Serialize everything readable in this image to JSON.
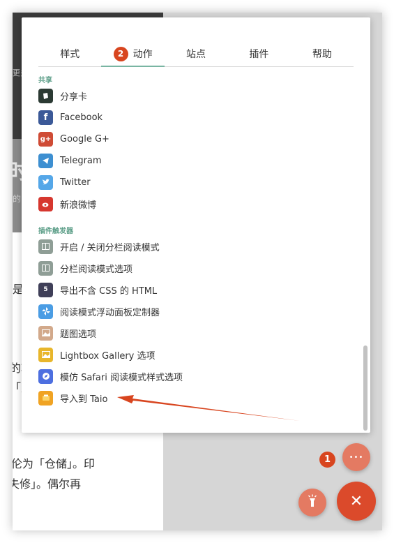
{
  "tabs": [
    {
      "label": "样式"
    },
    {
      "label": "动作",
      "badge": "2"
    },
    {
      "label": "站点"
    },
    {
      "label": "插件"
    },
    {
      "label": "帮助"
    }
  ],
  "share": {
    "title": "共享",
    "items": [
      {
        "label": "分享卡",
        "icon": "share-card-icon",
        "color": "#2b3a33"
      },
      {
        "label": "Facebook",
        "icon": "facebook-icon",
        "color": "#3b5998"
      },
      {
        "label": "Google G+",
        "icon": "google-plus-icon",
        "color": "#cf4b35"
      },
      {
        "label": "Telegram",
        "icon": "telegram-icon",
        "color": "#3d8fd1"
      },
      {
        "label": "Twitter",
        "icon": "twitter-icon",
        "color": "#55a7e8"
      },
      {
        "label": "新浪微博",
        "icon": "weibo-icon",
        "color": "#d6372f"
      }
    ]
  },
  "triggers": {
    "title": "插件触发器",
    "items": [
      {
        "label": "开启 / 关闭分栏阅读模式",
        "icon": "columns-icon",
        "color": "#8f9e96"
      },
      {
        "label": "分栏阅读模式选项",
        "icon": "columns-options-icon",
        "color": "#8f9e96"
      },
      {
        "label": "导出不含 CSS 的 HTML",
        "icon": "html5-icon",
        "color": "#3f3f58"
      },
      {
        "label": "阅读模式浮动面板定制器",
        "icon": "pinwheel-icon",
        "color": "#4b9de4"
      },
      {
        "label": "题图选项",
        "icon": "cover-image-icon",
        "color": "#d2a98b"
      },
      {
        "label": "Lightbox Gallery 选项",
        "icon": "gallery-icon",
        "color": "#e8b62b"
      },
      {
        "label": "模仿 Safari 阅读模式样式选项",
        "icon": "compass-icon",
        "color": "#4d6fe0"
      },
      {
        "label": "导入到 Taio",
        "icon": "taio-icon",
        "color": "#f0a323"
      }
    ]
  },
  "fabs": {
    "more_badge": "1",
    "more_label": "•••",
    "close_label": "✕"
  },
  "background": {
    "texts": [
      "更多",
      "时",
      "的",
      "是",
      "的巧",
      "「广",
      "伦为「仓储」。印",
      "失修」。偶尔再"
    ]
  },
  "colors": {
    "accent": "#79b5a2",
    "badge": "#d8451f",
    "fab_red": "#db4a2b",
    "fab_light": "#e47a62"
  }
}
